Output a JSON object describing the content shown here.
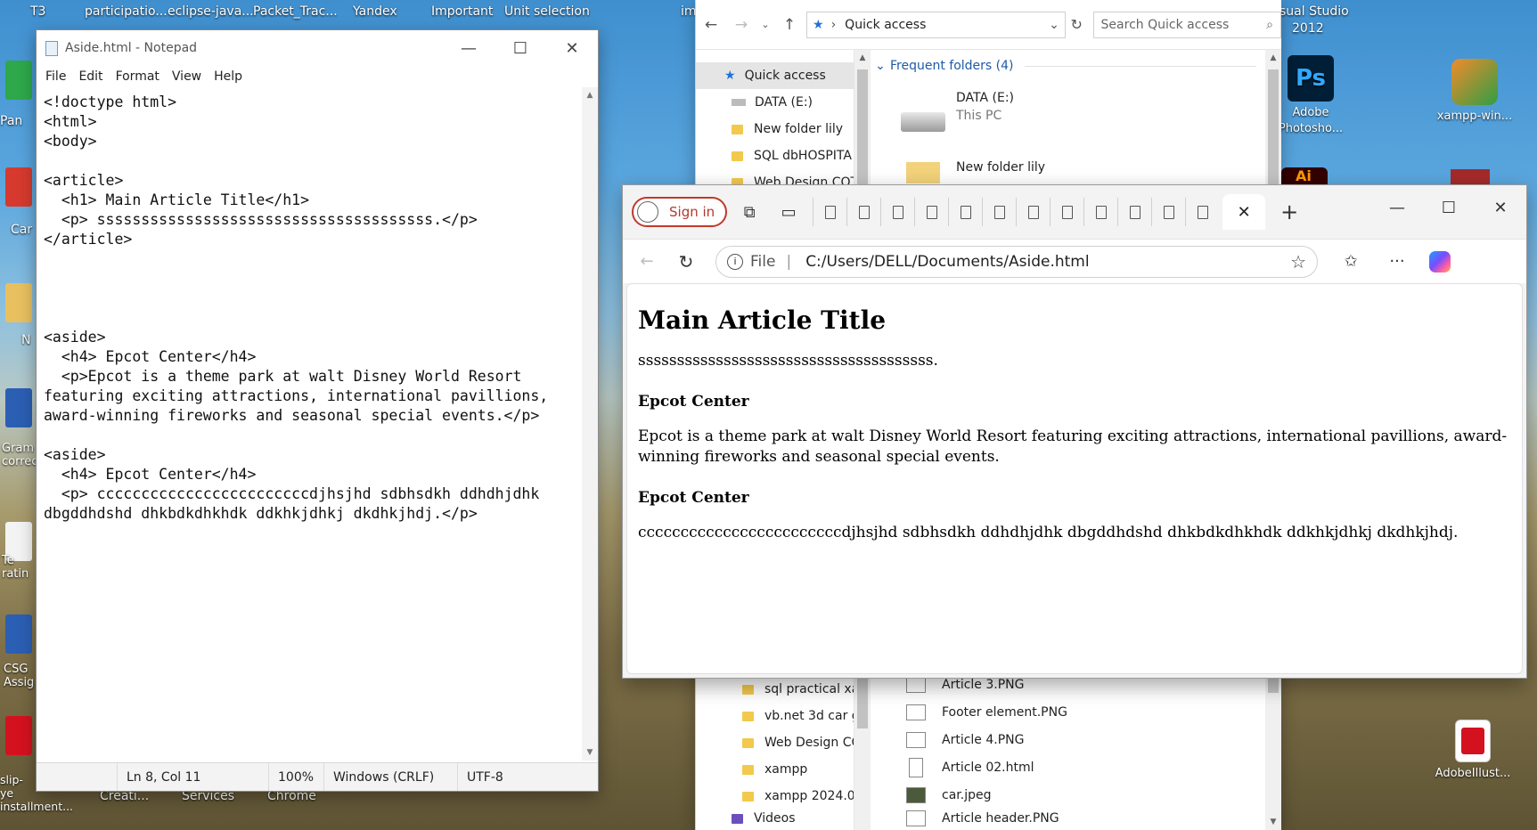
{
  "desktop": {
    "top_labels": [
      "T3",
      "participatio...",
      "eclipse-java...",
      "Packet_Trac...",
      "Yandex",
      "Important",
      "Unit selection",
      "im",
      "sual Studio",
      "2012"
    ],
    "icons_left": [
      "Pan",
      "Car",
      "N",
      "Gram correc",
      "Te ratin",
      "CSG Assig",
      "slip-ye installment..."
    ],
    "icons_right": [
      {
        "label": "Adobe Photosho...",
        "icon_text": "Ps",
        "color": "#001e36"
      },
      {
        "label": "xampp-win...",
        "icon_text": "",
        "color": "#f28b2b"
      },
      {
        "label": "Ai",
        "icon_text": "Ai",
        "color": "#330000"
      },
      {
        "label": "AdobeIllust...",
        "icon_text": "",
        "color": "#d4121f"
      }
    ],
    "bottom_labels": [
      "Creati...",
      "Services",
      "Chrome"
    ]
  },
  "notepad": {
    "title": "Aside.html - Notepad",
    "menu": [
      "File",
      "Edit",
      "Format",
      "View",
      "Help"
    ],
    "content": "<!doctype html>\n<html>\n<body>\n\n<article>\n  <h1> Main Article Title</h1>\n  <p> ssssssssssssssssssssssssssssssssssssss.</p>\n</article>\n\n\n\n\n<aside>\n  <h4> Epcot Center</h4>\n  <p>Epcot is a theme park at walt Disney World Resort\nfeaturing exciting attractions, international pavillions,\naward-winning fireworks and seasonal special events.</p>\n\n<aside>\n  <h4> Epcot Center</h4>\n  <p> ccccccccccccccccccccccccdjhsjhd sdbhsdkh ddhdhjdhk\ndbgddhdshd dhkbdkdhkhdk ddkhkjdhkj dkdhkjhdj.</p>",
    "status": {
      "position": "Ln 8, Col 11",
      "zoom": "100%",
      "line_ending": "Windows (CRLF)",
      "encoding": "UTF-8"
    }
  },
  "explorer": {
    "address": "Quick access",
    "search_placeholder": "Search Quick access",
    "section_title": "Frequent folders (4)",
    "nav_items": [
      {
        "label": "Quick access",
        "selected": true
      },
      {
        "label": "DATA (E:)"
      },
      {
        "label": "New folder lily"
      },
      {
        "label": "SQL dbHOSPITA"
      },
      {
        "label": "Web Design COT"
      }
    ],
    "nav_items_lower": [
      "sql practical xa",
      "vb.net 3d car g",
      "Web Design CO",
      "xampp",
      "xampp 2024.0",
      "Videos"
    ],
    "frequent": [
      {
        "name": "DATA (E:)",
        "sub": "This PC"
      },
      {
        "name": "New folder lily",
        "sub": ""
      }
    ],
    "recent_files": [
      "Article 3.PNG",
      "Footer element.PNG",
      "Article 4.PNG",
      "Article 02.html",
      "car.jpeg",
      "Article header.PNG"
    ]
  },
  "edge": {
    "signin_label": "Sign in",
    "url_prefix": "File",
    "url": "C:/Users/DELL/Documents/Aside.html",
    "page": {
      "h1": "Main Article Title",
      "p1": "ssssssssssssssssssssssssssssssssssssss.",
      "h4_1": "Epcot Center",
      "p2": "Epcot is a theme park at walt Disney World Resort featuring exciting attractions, international pavillions, award-winning fireworks and seasonal special events.",
      "h4_2": "Epcot Center",
      "p3": "ccccccccccccccccccccccccdjhsjhd sdbhsdkh ddhdhjdhk dbgddhdshd dhkbdkdhkhdk ddkhkjdhkj dkdhkjhdj."
    }
  }
}
